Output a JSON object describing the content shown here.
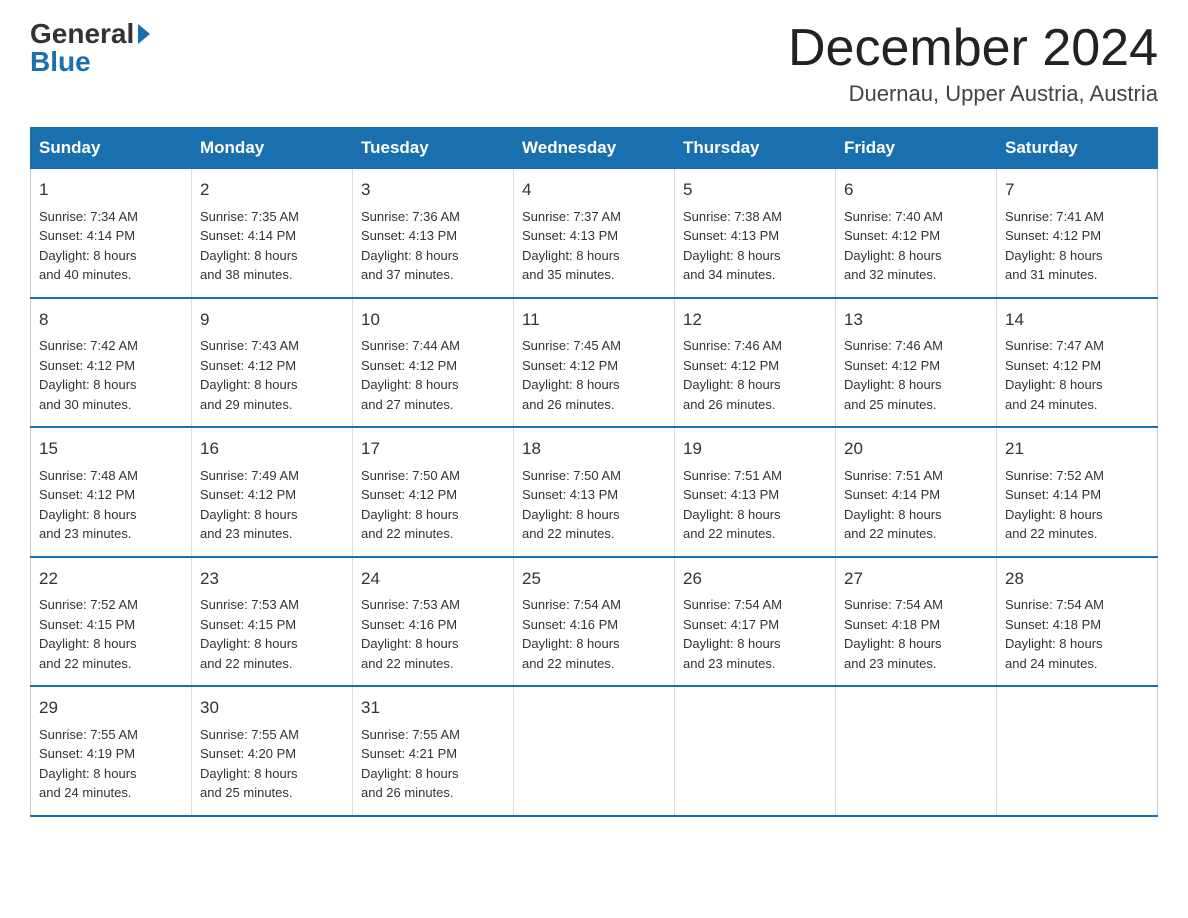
{
  "logo": {
    "general": "General",
    "blue": "Blue"
  },
  "title": "December 2024",
  "location": "Duernau, Upper Austria, Austria",
  "weekdays": [
    "Sunday",
    "Monday",
    "Tuesday",
    "Wednesday",
    "Thursday",
    "Friday",
    "Saturday"
  ],
  "weeks": [
    [
      {
        "day": "1",
        "sunrise": "7:34 AM",
        "sunset": "4:14 PM",
        "daylight": "8 hours and 40 minutes."
      },
      {
        "day": "2",
        "sunrise": "7:35 AM",
        "sunset": "4:14 PM",
        "daylight": "8 hours and 38 minutes."
      },
      {
        "day": "3",
        "sunrise": "7:36 AM",
        "sunset": "4:13 PM",
        "daylight": "8 hours and 37 minutes."
      },
      {
        "day": "4",
        "sunrise": "7:37 AM",
        "sunset": "4:13 PM",
        "daylight": "8 hours and 35 minutes."
      },
      {
        "day": "5",
        "sunrise": "7:38 AM",
        "sunset": "4:13 PM",
        "daylight": "8 hours and 34 minutes."
      },
      {
        "day": "6",
        "sunrise": "7:40 AM",
        "sunset": "4:12 PM",
        "daylight": "8 hours and 32 minutes."
      },
      {
        "day": "7",
        "sunrise": "7:41 AM",
        "sunset": "4:12 PM",
        "daylight": "8 hours and 31 minutes."
      }
    ],
    [
      {
        "day": "8",
        "sunrise": "7:42 AM",
        "sunset": "4:12 PM",
        "daylight": "8 hours and 30 minutes."
      },
      {
        "day": "9",
        "sunrise": "7:43 AM",
        "sunset": "4:12 PM",
        "daylight": "8 hours and 29 minutes."
      },
      {
        "day": "10",
        "sunrise": "7:44 AM",
        "sunset": "4:12 PM",
        "daylight": "8 hours and 27 minutes."
      },
      {
        "day": "11",
        "sunrise": "7:45 AM",
        "sunset": "4:12 PM",
        "daylight": "8 hours and 26 minutes."
      },
      {
        "day": "12",
        "sunrise": "7:46 AM",
        "sunset": "4:12 PM",
        "daylight": "8 hours and 26 minutes."
      },
      {
        "day": "13",
        "sunrise": "7:46 AM",
        "sunset": "4:12 PM",
        "daylight": "8 hours and 25 minutes."
      },
      {
        "day": "14",
        "sunrise": "7:47 AM",
        "sunset": "4:12 PM",
        "daylight": "8 hours and 24 minutes."
      }
    ],
    [
      {
        "day": "15",
        "sunrise": "7:48 AM",
        "sunset": "4:12 PM",
        "daylight": "8 hours and 23 minutes."
      },
      {
        "day": "16",
        "sunrise": "7:49 AM",
        "sunset": "4:12 PM",
        "daylight": "8 hours and 23 minutes."
      },
      {
        "day": "17",
        "sunrise": "7:50 AM",
        "sunset": "4:12 PM",
        "daylight": "8 hours and 22 minutes."
      },
      {
        "day": "18",
        "sunrise": "7:50 AM",
        "sunset": "4:13 PM",
        "daylight": "8 hours and 22 minutes."
      },
      {
        "day": "19",
        "sunrise": "7:51 AM",
        "sunset": "4:13 PM",
        "daylight": "8 hours and 22 minutes."
      },
      {
        "day": "20",
        "sunrise": "7:51 AM",
        "sunset": "4:14 PM",
        "daylight": "8 hours and 22 minutes."
      },
      {
        "day": "21",
        "sunrise": "7:52 AM",
        "sunset": "4:14 PM",
        "daylight": "8 hours and 22 minutes."
      }
    ],
    [
      {
        "day": "22",
        "sunrise": "7:52 AM",
        "sunset": "4:15 PM",
        "daylight": "8 hours and 22 minutes."
      },
      {
        "day": "23",
        "sunrise": "7:53 AM",
        "sunset": "4:15 PM",
        "daylight": "8 hours and 22 minutes."
      },
      {
        "day": "24",
        "sunrise": "7:53 AM",
        "sunset": "4:16 PM",
        "daylight": "8 hours and 22 minutes."
      },
      {
        "day": "25",
        "sunrise": "7:54 AM",
        "sunset": "4:16 PM",
        "daylight": "8 hours and 22 minutes."
      },
      {
        "day": "26",
        "sunrise": "7:54 AM",
        "sunset": "4:17 PM",
        "daylight": "8 hours and 23 minutes."
      },
      {
        "day": "27",
        "sunrise": "7:54 AM",
        "sunset": "4:18 PM",
        "daylight": "8 hours and 23 minutes."
      },
      {
        "day": "28",
        "sunrise": "7:54 AM",
        "sunset": "4:18 PM",
        "daylight": "8 hours and 24 minutes."
      }
    ],
    [
      {
        "day": "29",
        "sunrise": "7:55 AM",
        "sunset": "4:19 PM",
        "daylight": "8 hours and 24 minutes."
      },
      {
        "day": "30",
        "sunrise": "7:55 AM",
        "sunset": "4:20 PM",
        "daylight": "8 hours and 25 minutes."
      },
      {
        "day": "31",
        "sunrise": "7:55 AM",
        "sunset": "4:21 PM",
        "daylight": "8 hours and 26 minutes."
      },
      null,
      null,
      null,
      null
    ]
  ],
  "labels": {
    "sunrise": "Sunrise:",
    "sunset": "Sunset:",
    "daylight": "Daylight:"
  }
}
